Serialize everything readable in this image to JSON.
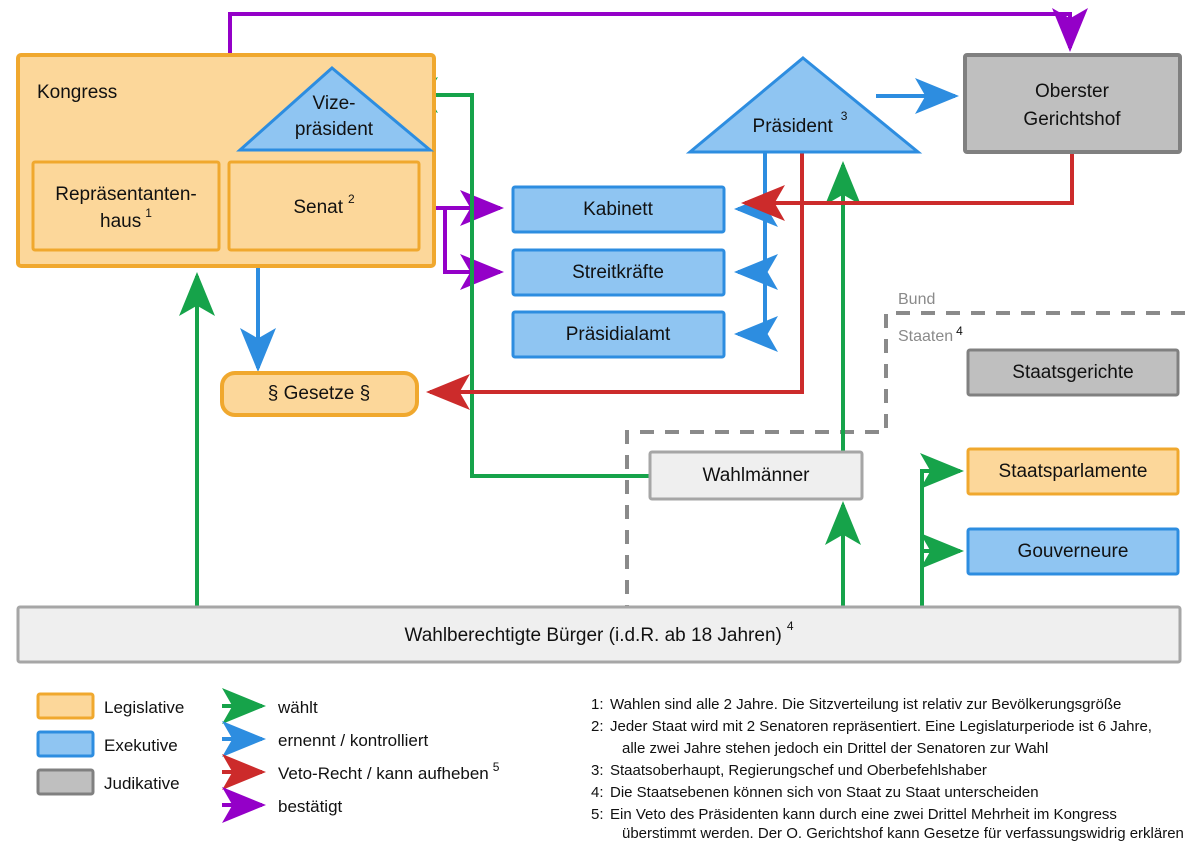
{
  "title": "Politisches System der Vereinigten Staaten",
  "colors": {
    "legislative_fill": "#fcd79a",
    "legislative_stroke": "#f0a82e",
    "executive_fill": "#8fc5f2",
    "executive_stroke": "#2d8de0",
    "judicative_fill": "#bfbfbf",
    "judicative_stroke": "#808080",
    "neutral_fill": "#efefef",
    "neutral_stroke": "#a6a6a6",
    "green": "#16a34a",
    "blue": "#2d8de0",
    "red": "#cc2b2b",
    "purple": "#9400c8",
    "boundary": "#8a8a8a"
  },
  "nodes": {
    "kongress": "Kongress",
    "vizepraesident_line1": "Vize-",
    "vizepraesident_line2": "präsident",
    "repraesentantenhaus_line1": "Repräsentanten-",
    "repraesentantenhaus_line2": "haus",
    "repraesentantenhaus_sup": "1",
    "senat": "Senat",
    "senat_sup": "2",
    "praesident": "Präsident",
    "praesident_sup": "3",
    "oberster_gerichtshof_line1": "Oberster",
    "oberster_gerichtshof_line2": "Gerichtshof",
    "kabinett": "Kabinett",
    "streitkraefte": "Streitkräfte",
    "praesidialamt": "Präsidialamt",
    "gesetze": "§ Gesetze §",
    "staatsgerichte": "Staatsgerichte",
    "staatsparlamente": "Staatsparlamente",
    "gouverneure": "Gouverneure",
    "wahlmaenner": "Wahlmänner",
    "buerger": "Wahlberechtigte Bürger (i.d.R. ab 18 Jahren)",
    "buerger_sup": "4"
  },
  "boundaries": {
    "bund": "Bund",
    "staaten": "Staaten",
    "staaten_sup": "4"
  },
  "legend": {
    "branches": [
      {
        "label": "Legislative",
        "fill": "#fcd79a",
        "stroke": "#f0a82e"
      },
      {
        "label": "Exekutive",
        "fill": "#8fc5f2",
        "stroke": "#2d8de0"
      },
      {
        "label": "Judikative",
        "fill": "#bfbfbf",
        "stroke": "#808080"
      }
    ],
    "relations": [
      {
        "label": "wählt",
        "color": "#16a34a",
        "sup": ""
      },
      {
        "label": "ernennt / kontrolliert",
        "color": "#2d8de0",
        "sup": ""
      },
      {
        "label": "Veto-Recht / kann aufheben",
        "color": "#cc2b2b",
        "sup": "5"
      },
      {
        "label": "bestätigt",
        "color": "#9400c8",
        "sup": ""
      }
    ]
  },
  "notes": [
    {
      "num": "1:",
      "lines": [
        "Wahlen sind alle 2 Jahre. Die Sitzverteilung ist relativ zur Bevölkerungsgröße"
      ]
    },
    {
      "num": "2:",
      "lines": [
        "Jeder Staat wird mit 2 Senatoren repräsentiert. Eine Legislaturperiode ist 6 Jahre,",
        "alle zwei Jahre stehen jedoch ein Drittel der Senatoren zur Wahl"
      ]
    },
    {
      "num": "3:",
      "lines": [
        "Staatsoberhaupt, Regierungschef und Oberbefehlshaber"
      ]
    },
    {
      "num": "4:",
      "lines": [
        "Die Staatsebenen können sich von Staat zu Staat unterscheiden"
      ]
    },
    {
      "num": "5:",
      "lines": [
        "Ein Veto des Präsidenten kann durch eine zwei Drittel Mehrheit im Kongress",
        "überstimmt werden. Der O. Gerichtshof kann Gesetze für verfassungswidrig erklären"
      ]
    }
  ]
}
